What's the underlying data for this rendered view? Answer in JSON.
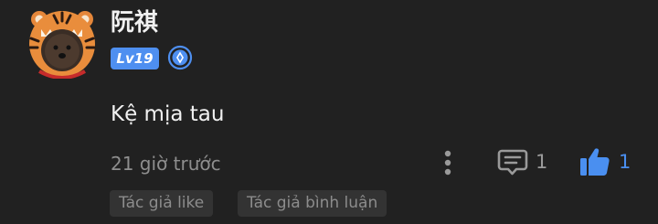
{
  "comment": {
    "author": {
      "name": "阮祺",
      "level": "Lv19",
      "avatar_icon": "tiger-hat-avatar",
      "medal_icon": "blue-medal-icon"
    },
    "text": "Kệ mịa tau",
    "timestamp": "21 giờ trước",
    "actions": {
      "more_icon": "more-vertical-icon",
      "reply_icon": "comment-icon",
      "reply_count": "1",
      "like_icon": "thumbs-up-icon",
      "like_count": "1",
      "liked": true
    },
    "tags": [
      "Tác giả like",
      "Tác giả bình luận"
    ]
  },
  "colors": {
    "background": "#212121",
    "level_badge": "#4e8ff0",
    "like_active": "#4a8ff0",
    "tag_background": "#333333"
  }
}
